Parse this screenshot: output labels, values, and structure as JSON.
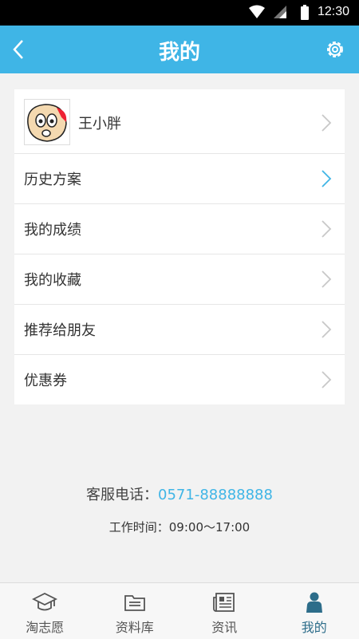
{
  "status_bar": {
    "time": "12:30"
  },
  "header": {
    "title": "我的"
  },
  "profile": {
    "name": "王小胖"
  },
  "menu": [
    {
      "label": "历史方案",
      "highlight": true
    },
    {
      "label": "我的成绩",
      "highlight": false
    },
    {
      "label": "我的收藏",
      "highlight": false
    },
    {
      "label": "推荐给朋友",
      "highlight": false
    },
    {
      "label": "优惠券",
      "highlight": false
    }
  ],
  "contact": {
    "phone_label": "客服电话：",
    "phone_number": "0571-88888888",
    "hours": "工作时间：09:00～17:00"
  },
  "tabs": [
    {
      "label": "淘志愿",
      "icon": "graduation-cap-icon"
    },
    {
      "label": "资料库",
      "icon": "folder-icon"
    },
    {
      "label": "资讯",
      "icon": "newspaper-icon"
    },
    {
      "label": "我的",
      "icon": "person-icon",
      "active": true
    }
  ],
  "colors": {
    "accent": "#3fb5e6",
    "active_tab": "#2d6d8a"
  }
}
